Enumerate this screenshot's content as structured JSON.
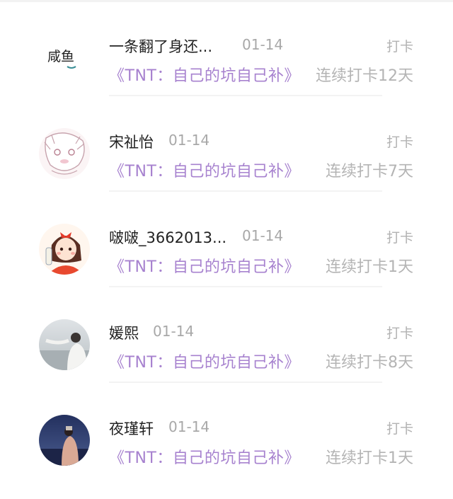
{
  "records": [
    {
      "avatar": "handwritten-avatar",
      "avatar_text": "咸鱼",
      "name": "一条翻了身还...",
      "date": "01-14",
      "checkin": "打卡",
      "book": "《TNT：自己的坑自己补》",
      "streak": "连续打卡12天"
    },
    {
      "avatar": "anime-sketch-avatar",
      "name": "宋祉怡",
      "date": "01-14",
      "checkin": "打卡",
      "book": "《TNT：自己的坑自己补》",
      "streak": "连续打卡7天"
    },
    {
      "avatar": "cartoon-girl-avatar",
      "name": "啵啵_3662013...",
      "date": "01-14",
      "checkin": "打卡",
      "book": "《TNT：自己的坑自己补》",
      "streak": "连续打卡1天"
    },
    {
      "avatar": "photo-avatar",
      "name": "媛熙",
      "date": "01-14",
      "checkin": "打卡",
      "book": "《TNT：自己的坑自己补》",
      "streak": "连续打卡8天"
    },
    {
      "avatar": "night-sea-photo-avatar",
      "name": "夜瑾轩",
      "date": "01-14",
      "checkin": "打卡",
      "book": "《TNT：自己的坑自己补》",
      "streak": "连续打卡1天"
    }
  ],
  "colors": {
    "book_title": "#a782cf",
    "name": "#222222",
    "muted": "#a8a8a8"
  }
}
